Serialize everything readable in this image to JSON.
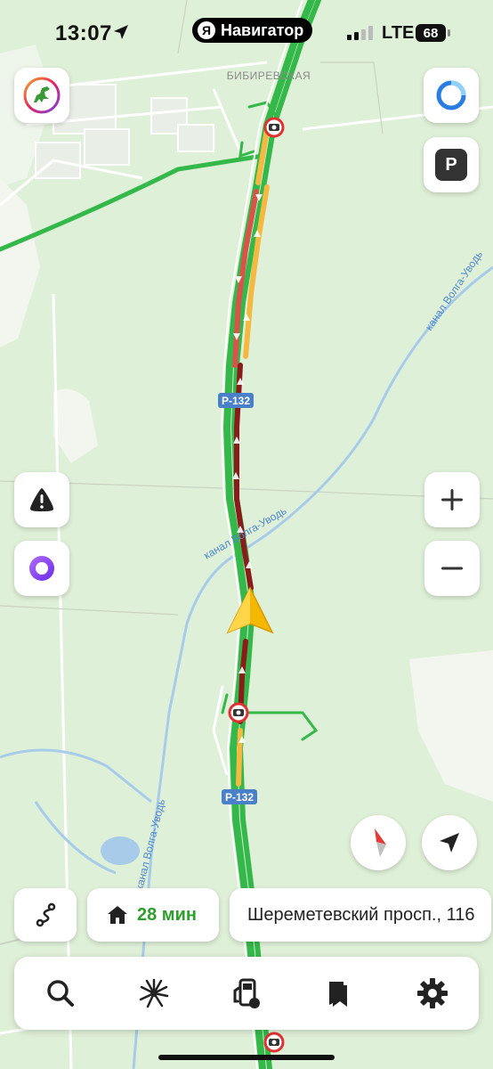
{
  "status_bar": {
    "time": "13:07",
    "app_name": "Навигатор",
    "app_badge": "Я",
    "network": "LTE",
    "battery": "68"
  },
  "map": {
    "places": [
      "БИБИРЕВСКАЯ"
    ],
    "road_labels": [
      "Р-132",
      "Р-132"
    ],
    "canal_labels": [
      "канал Волга-Уводь",
      "канал Волга-Уводь",
      "канал Волга-Уводь"
    ],
    "colors": {
      "land": "#dff0d8",
      "route_green": "#35b84a",
      "jam_red": "#d9534a",
      "jam_orange": "#f5b942",
      "jam_darkred": "#8b1c1c",
      "water": "#a7cbe9",
      "cursor": "#f5b800"
    }
  },
  "controls": {
    "avatar_icon": "dinosaur-icon",
    "alice_icon": "alice-icon",
    "parking_letter": "P",
    "zoom_in": "+",
    "zoom_out": "−"
  },
  "route_bar": {
    "eta": "28 мин",
    "destination": "Шереметевский просп., 116"
  },
  "tab_bar": {
    "items": [
      {
        "icon": "search-icon"
      },
      {
        "icon": "discovery-icon"
      },
      {
        "icon": "fuel-icon"
      },
      {
        "icon": "bookmarks-icon"
      },
      {
        "icon": "settings-icon"
      }
    ]
  }
}
